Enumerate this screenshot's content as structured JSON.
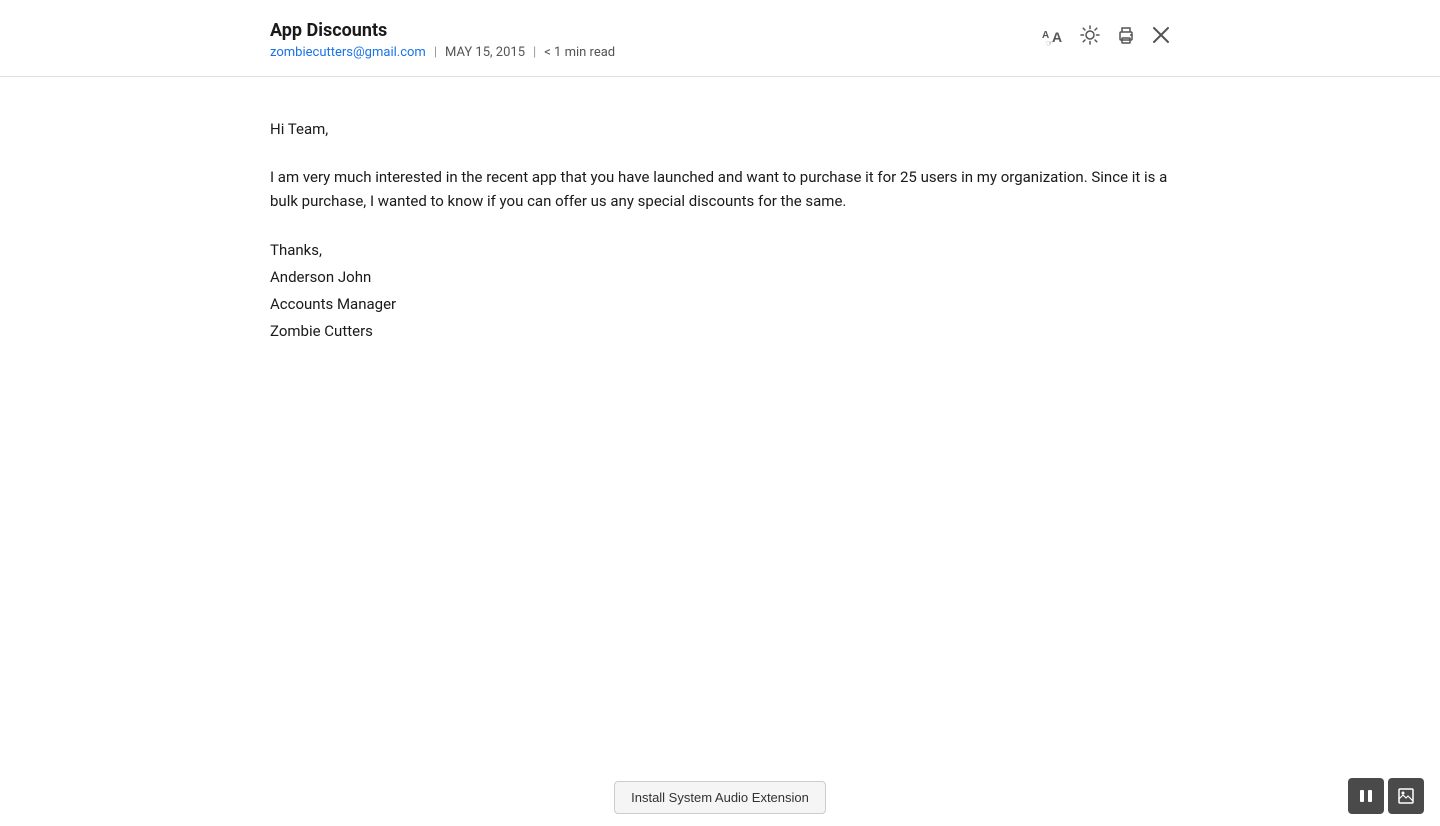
{
  "header": {
    "subject": "App Discounts",
    "sender": "zombiecutters@gmail.com",
    "date": "MAY 15, 2015",
    "read_time": "< 1 min read",
    "separator": "|"
  },
  "toolbar": {
    "text_size_icon": "text-size",
    "brightness_icon": "brightness",
    "print_icon": "print",
    "close_icon": "close"
  },
  "body": {
    "greeting": "Hi Team,",
    "paragraph1": "I am very much interested in the recent app that you have launched and want to purchase it for 25 users in my organization. Since it is a bulk purchase, I wanted to know if you can offer us any special discounts for the same.",
    "signature_thanks": "Thanks,",
    "signature_name": "Anderson John",
    "signature_title": "Accounts Manager",
    "signature_company": "Zombie Cutters"
  },
  "bottom": {
    "install_button_label": "Install System Audio Extension"
  },
  "controls": {
    "pause_icon": "❚❚",
    "image_icon": "⊡"
  }
}
